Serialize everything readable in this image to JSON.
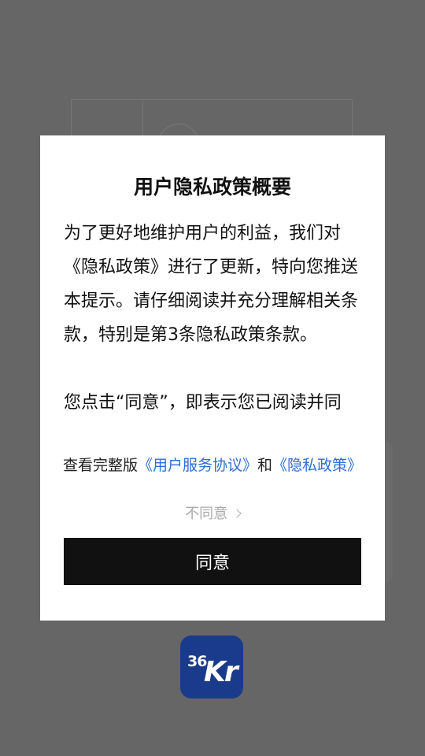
{
  "dialog": {
    "title": "用户隐私政策概要",
    "paragraphs": [
      "为了更好地维护用户的利益，我们对《隐私政策》进行了更新，特向您推送本提示。请仔细阅读并充分理解相关条款，特别是第3条隐私政策条款。",
      "您点击“同意”，即表示您已阅读并同"
    ],
    "links_prefix": "查看完整版",
    "link_user_agreement": "《用户服务协议》",
    "links_conjunction": "和",
    "link_privacy_policy": "《隐私政策》",
    "disagree_label": "不同意",
    "agree_label": "同意"
  },
  "logo": {
    "number": "36",
    "letters": "Kr",
    "color": "#1a3b8c"
  },
  "colors": {
    "overlay": "#666666",
    "link": "#2e6ed6",
    "button": "#111111"
  }
}
